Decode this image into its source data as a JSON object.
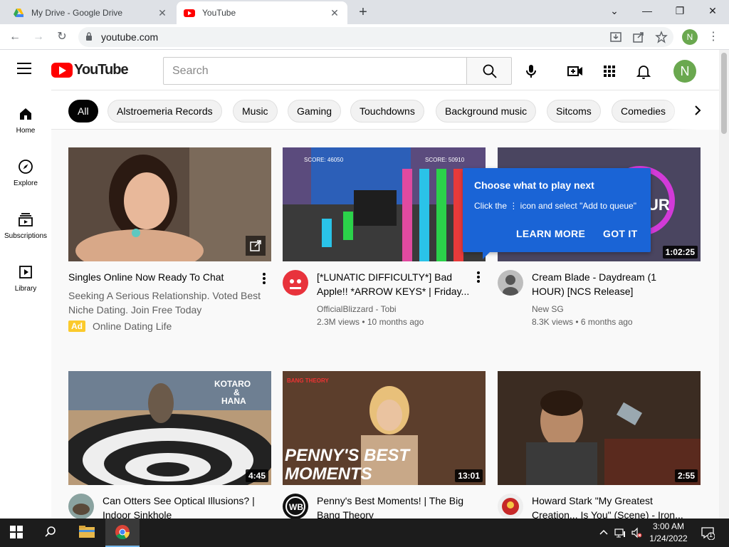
{
  "browser": {
    "tabs": [
      {
        "label": "My Drive - Google Drive",
        "active": false
      },
      {
        "label": "YouTube",
        "active": true
      }
    ],
    "new_tab": "+",
    "url": "youtube.com",
    "profile_initial": "N"
  },
  "header": {
    "logo_text": "YouTube",
    "search_placeholder": "Search",
    "avatar_initial": "N"
  },
  "sidebar": {
    "items": [
      {
        "label": "Home",
        "icon": "home-icon"
      },
      {
        "label": "Explore",
        "icon": "compass-icon"
      },
      {
        "label": "Subscriptions",
        "icon": "subscriptions-icon"
      },
      {
        "label": "Library",
        "icon": "library-icon"
      }
    ]
  },
  "chips": [
    "All",
    "Alstroemeria Records",
    "Music",
    "Gaming",
    "Touchdowns",
    "Background music",
    "Sitcoms",
    "Comedies"
  ],
  "videos": [
    {
      "title": "Singles Online Now Ready To Chat",
      "description": "Seeking A Serious Relationship. Voted Best Niche Dating. Join Free Today",
      "ad_badge": "Ad",
      "advertiser": "Online Dating Life"
    },
    {
      "title": "[*LUNATIC DIFFICULTY*] Bad Apple!! *ARROW KEYS* | Friday...",
      "channel": "OfficialBlizzard - Tobi",
      "stats": "2.3M views • 10 months ago",
      "thumb_score_left": "SCORE: 46050",
      "thumb_score_right": "SCORE: 50910"
    },
    {
      "title": "Cream Blade - Daydream (1 HOUR) [NCS Release]",
      "channel": "New SG",
      "stats": "8.3K views • 6 months ago",
      "duration": "1:02:25",
      "thumb_text": "UR"
    },
    {
      "title": "Can Otters See Optical Illusions? | Indoor Sinkhole",
      "duration": "4:45",
      "thumb_text_1": "KOTARO",
      "thumb_text_2": "&",
      "thumb_text_3": "HANA"
    },
    {
      "title": "Penny's Best Moments! | The Big Bang Theory",
      "duration": "13:01",
      "thumb_text_1": "PENNY'S BEST",
      "thumb_text_2": "MOMENTS",
      "thumb_badge": "BANG THEORY"
    },
    {
      "title": "Howard Stark \"My Greatest Creation... Is You\" (Scene) - Iron...",
      "duration": "2:55"
    }
  ],
  "popup": {
    "title": "Choose what to play next",
    "body": "Click the ⋮ icon and select \"Add to queue\"",
    "learn_more": "LEARN MORE",
    "got_it": "GOT IT"
  },
  "taskbar": {
    "time": "3:00 AM",
    "date": "1/24/2022",
    "notification_count": "1"
  },
  "colors": {
    "youtube_red": "#ff0000",
    "popup_blue": "#1a64d6",
    "avatar_green": "#6aa84f"
  }
}
